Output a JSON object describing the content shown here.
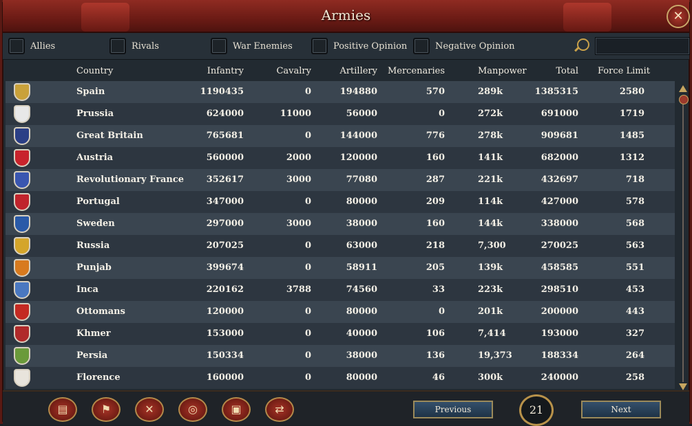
{
  "window": {
    "title": "Armies",
    "close_glyph": "✕"
  },
  "filters": [
    {
      "label": "Allies"
    },
    {
      "label": "Rivals"
    },
    {
      "label": "War Enemies"
    },
    {
      "label": "Positive Opinion"
    },
    {
      "label": "Negative Opinion"
    }
  ],
  "search": {
    "placeholder": ""
  },
  "columns": {
    "country": "Country",
    "infantry": "Infantry",
    "cavalry": "Cavalry",
    "artillery": "Artillery",
    "mercenaries": "Mercenaries",
    "manpower": "Manpower",
    "total": "Total",
    "force_limit": "Force Limit"
  },
  "rows": [
    {
      "country": "Spain",
      "infantry": "1190435",
      "cavalry": "0",
      "artillery": "194880",
      "mercenaries": "570",
      "manpower": "289k",
      "total": "1385315",
      "force_limit": "2580",
      "flag": "#c9a13a"
    },
    {
      "country": "Prussia",
      "infantry": "624000",
      "cavalry": "11000",
      "artillery": "56000",
      "mercenaries": "0",
      "manpower": "272k",
      "total": "691000",
      "force_limit": "1719",
      "flag": "#e8e8e8"
    },
    {
      "country": "Great Britain",
      "infantry": "765681",
      "cavalry": "0",
      "artillery": "144000",
      "mercenaries": "776",
      "manpower": "278k",
      "total": "909681",
      "force_limit": "1485",
      "flag": "#2b3f86"
    },
    {
      "country": "Austria",
      "infantry": "560000",
      "cavalry": "2000",
      "artillery": "120000",
      "mercenaries": "160",
      "manpower": "141k",
      "total": "682000",
      "force_limit": "1312",
      "flag": "#c8232c"
    },
    {
      "country": "Revolutionary France",
      "infantry": "352617",
      "cavalry": "3000",
      "artillery": "77080",
      "mercenaries": "287",
      "manpower": "221k",
      "total": "432697",
      "force_limit": "718",
      "flag": "#3a56b0"
    },
    {
      "country": "Portugal",
      "infantry": "347000",
      "cavalry": "0",
      "artillery": "80000",
      "mercenaries": "209",
      "manpower": "114k",
      "total": "427000",
      "force_limit": "578",
      "flag": "#c0242c"
    },
    {
      "country": "Sweden",
      "infantry": "297000",
      "cavalry": "3000",
      "artillery": "38000",
      "mercenaries": "160",
      "manpower": "144k",
      "total": "338000",
      "force_limit": "568",
      "flag": "#2a5aa8"
    },
    {
      "country": "Russia",
      "infantry": "207025",
      "cavalry": "0",
      "artillery": "63000",
      "mercenaries": "218",
      "manpower": "7,300",
      "total": "270025",
      "force_limit": "563",
      "flag": "#d4a52a"
    },
    {
      "country": "Punjab",
      "infantry": "399674",
      "cavalry": "0",
      "artillery": "58911",
      "mercenaries": "205",
      "manpower": "139k",
      "total": "458585",
      "force_limit": "551",
      "flag": "#d87a1e"
    },
    {
      "country": "Inca",
      "infantry": "220162",
      "cavalry": "3788",
      "artillery": "74560",
      "mercenaries": "33",
      "manpower": "223k",
      "total": "298510",
      "force_limit": "453",
      "flag": "#4a78c0"
    },
    {
      "country": "Ottomans",
      "infantry": "120000",
      "cavalry": "0",
      "artillery": "80000",
      "mercenaries": "0",
      "manpower": "201k",
      "total": "200000",
      "force_limit": "443",
      "flag": "#c42a22"
    },
    {
      "country": "Khmer",
      "infantry": "153000",
      "cavalry": "0",
      "artillery": "40000",
      "mercenaries": "106",
      "manpower": "7,414",
      "total": "193000",
      "force_limit": "327",
      "flag": "#b02a2a"
    },
    {
      "country": "Persia",
      "infantry": "150334",
      "cavalry": "0",
      "artillery": "38000",
      "mercenaries": "136",
      "manpower": "19,373",
      "total": "188334",
      "force_limit": "264",
      "flag": "#6a9a3a"
    },
    {
      "country": "Florence",
      "infantry": "160000",
      "cavalry": "0",
      "artillery": "80000",
      "mercenaries": "46",
      "manpower": "300k",
      "total": "240000",
      "force_limit": "258",
      "flag": "#e8e4dc"
    }
  ],
  "bottom": {
    "tabs": [
      {
        "icon": "ledger-icon",
        "glyph": "▤"
      },
      {
        "icon": "flag-icon",
        "glyph": "⚑"
      },
      {
        "icon": "crossed-swords-icon",
        "glyph": "✕"
      },
      {
        "icon": "coins-icon",
        "glyph": "◎"
      },
      {
        "icon": "crate-icon",
        "glyph": "▣"
      },
      {
        "icon": "handshake-icon",
        "glyph": "⇄"
      }
    ],
    "previous_label": "Previous",
    "next_label": "Next",
    "page": "21"
  }
}
